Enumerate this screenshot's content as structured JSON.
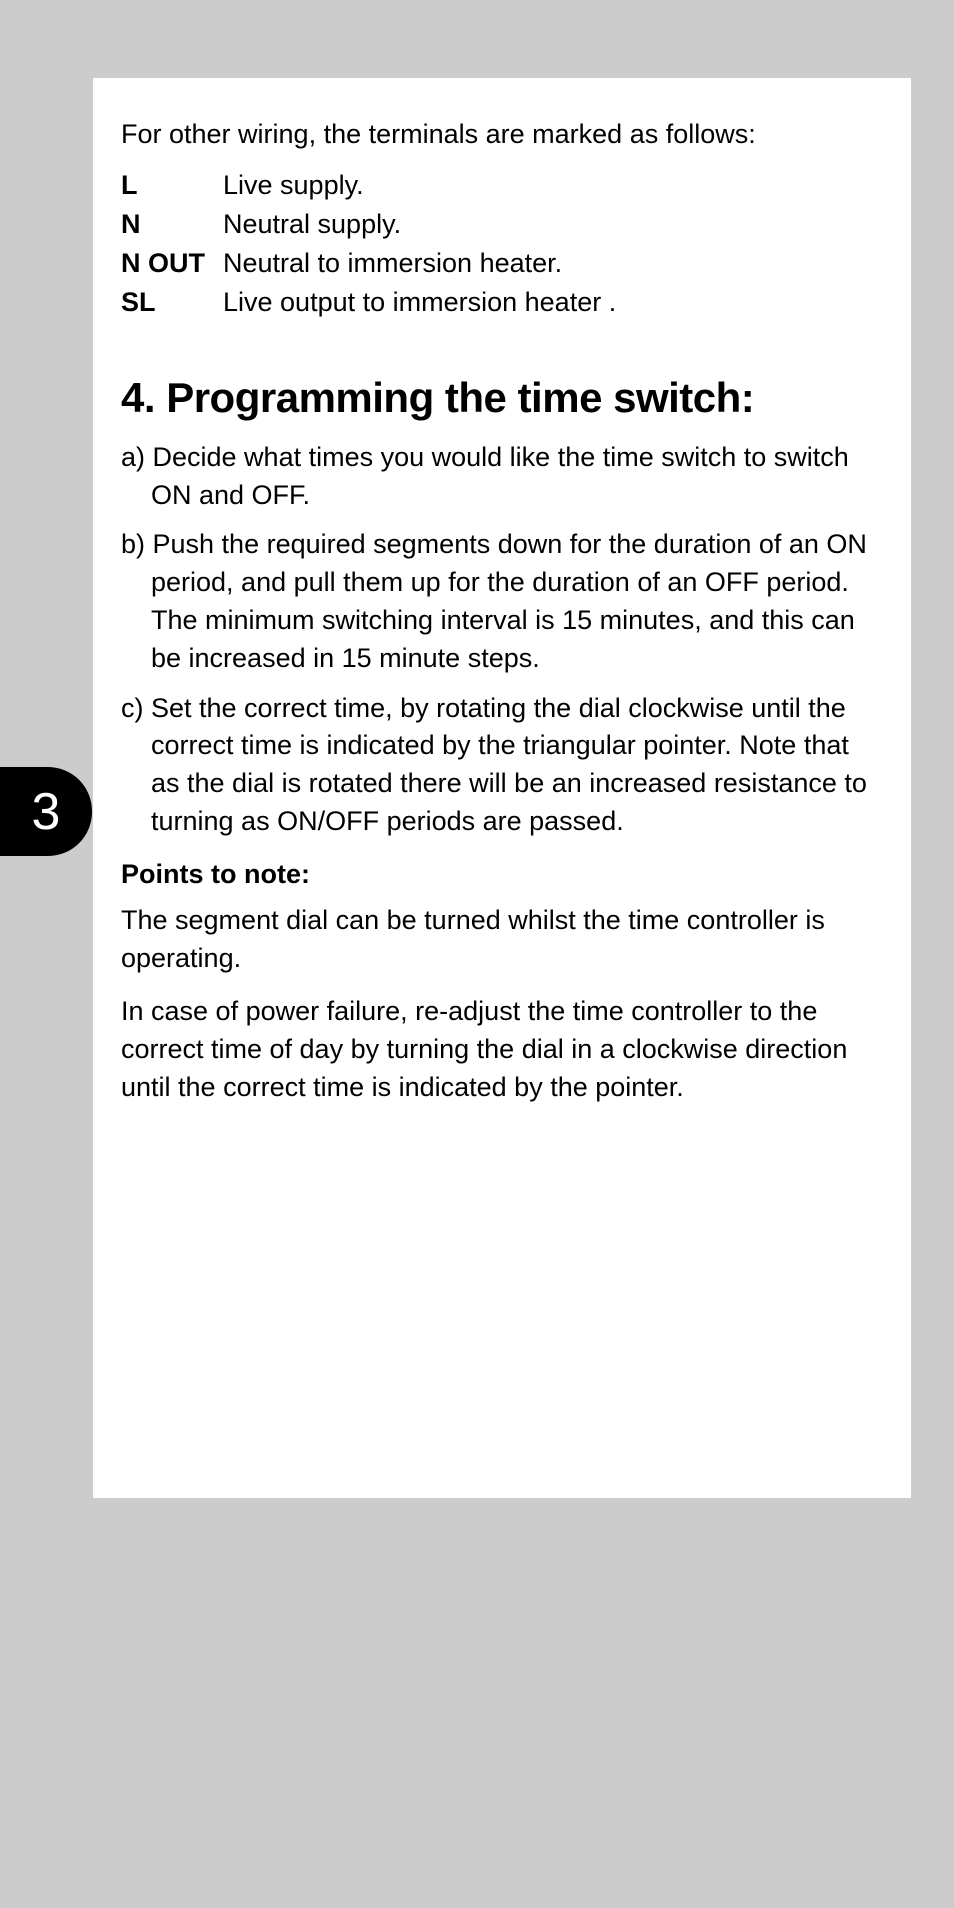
{
  "intro": "For other wiring, the terminals are marked as follows:",
  "terminals": [
    {
      "label": "L",
      "desc": "Live supply."
    },
    {
      "label": "N",
      "desc": "Neutral supply."
    },
    {
      "label": "N OUT",
      "desc": "Neutral to immersion heater."
    },
    {
      "label": "SL",
      "desc": "Live output to immersion heater ."
    }
  ],
  "heading": "4. Programming the time switch:",
  "steps": [
    "a) Decide what times you would like the time switch to switch ON and OFF.",
    "b) Push the required segments down for the duration of an ON period, and pull them up for the duration of an OFF period. The minimum switching interval is 15 minutes, and this can be increased in 15 minute steps.",
    "c) Set the correct time, by rotating the dial clockwise until the correct time is indicated by the triangular pointer. Note that as the dial is rotated there will be an increased resistance to turning as ON/OFF periods are passed."
  ],
  "points_heading": "Points to note:",
  "notes": [
    "The segment dial can be turned whilst the time controller is operating.",
    "In case of power failure, re-adjust the time controller to the correct time of day by turning the dial in a clockwise direction until the correct time is indicated by the pointer."
  ],
  "page_number": "3"
}
